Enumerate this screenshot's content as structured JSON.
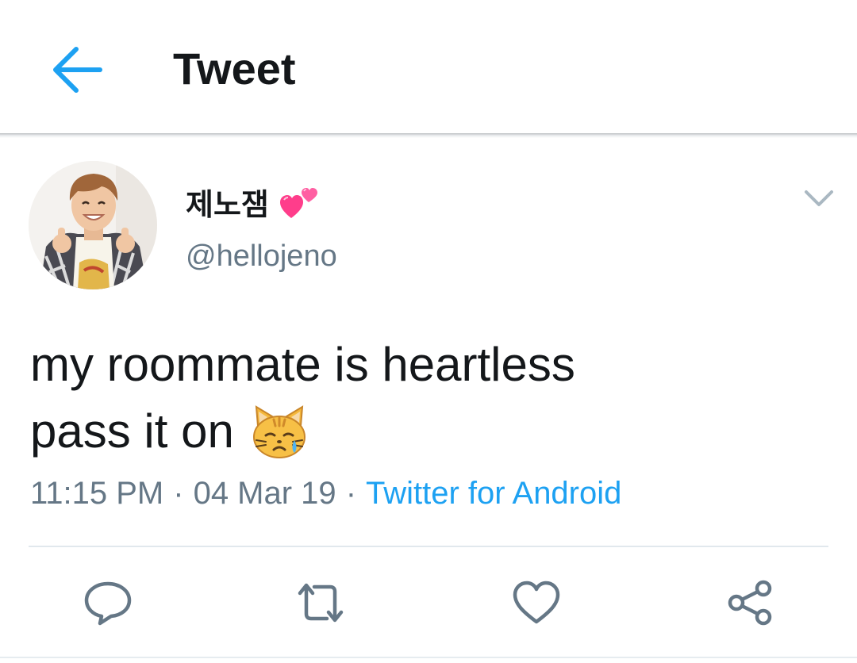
{
  "header": {
    "title": "Tweet",
    "back_icon": "arrow-left-icon",
    "accent_color": "#1da1f2"
  },
  "tweet": {
    "author": {
      "display_name": "제노잼",
      "name_emoji": "two-hearts-icon",
      "handle": "@hellojeno"
    },
    "text_lines": [
      "my roommate is heartless",
      "pass it on"
    ],
    "text_emoji": "crying-cat-face-icon",
    "time": "11:15 PM",
    "date": "04 Mar 19",
    "separator": "·",
    "source": "Twitter for Android",
    "caret_icon": "chevron-down-icon"
  },
  "actions": [
    {
      "name": "reply",
      "icon": "reply-icon"
    },
    {
      "name": "retweet",
      "icon": "retweet-icon"
    },
    {
      "name": "like",
      "icon": "heart-outline-icon"
    },
    {
      "name": "share",
      "icon": "share-icon"
    }
  ],
  "colors": {
    "text_primary": "#14171a",
    "text_secondary": "#657786",
    "icon_gray": "#657786",
    "divider": "#e1e8ed"
  }
}
